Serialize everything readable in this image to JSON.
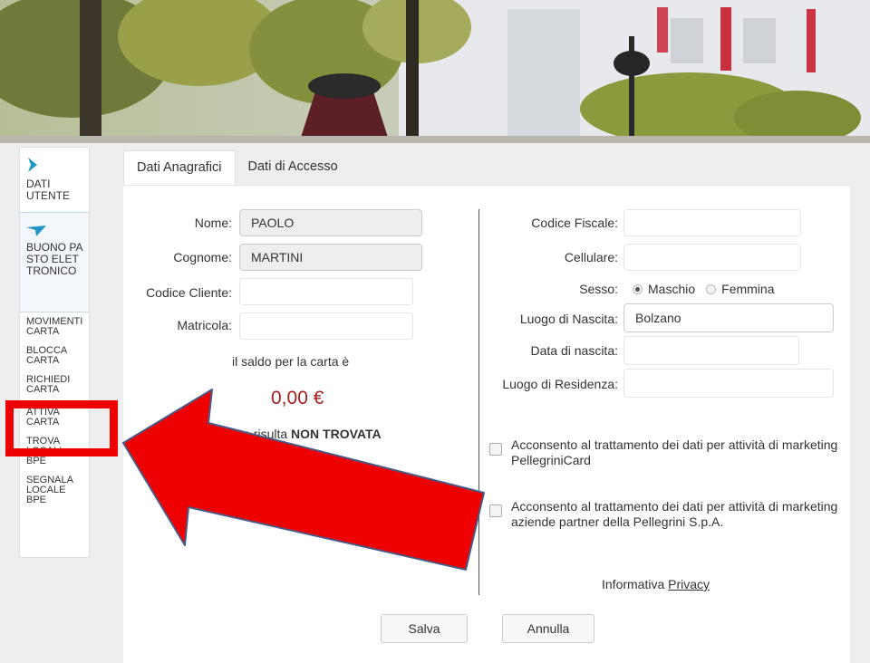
{
  "banner": {
    "icon": "street-photo-banner"
  },
  "sidebar": {
    "user_section": {
      "label": "DATI UTENTE",
      "icon": "chevron-right-icon"
    },
    "bpe_section": {
      "label": "BUONO PASTO ELETTRONICO",
      "icon": "chevron-down-icon"
    },
    "items": [
      {
        "label": "MOVIMENTI\nCARTA"
      },
      {
        "label": "BLOCCA\nCARTA"
      },
      {
        "label": "RICHIEDI\nCARTA"
      },
      {
        "label": "ATTIVA\nCARTA"
      },
      {
        "label": "TROVA\nLOCALI\nBPE"
      },
      {
        "label": "SEGNALA\nLOCALE\nBPE"
      }
    ]
  },
  "tabs": [
    {
      "label": "Dati Anagrafici",
      "active": true
    },
    {
      "label": "Dati di Accesso",
      "active": false
    }
  ],
  "form": {
    "nome": {
      "label": "Nome:",
      "value": "PAOLO"
    },
    "cognome": {
      "label": "Cognome:",
      "value": "MARTINI"
    },
    "codice_cliente": {
      "label": "Codice Cliente:",
      "value": ""
    },
    "matricola": {
      "label": "Matricola:",
      "value": ""
    },
    "codice_fiscale": {
      "label": "Codice Fiscale:",
      "value": ""
    },
    "cellulare": {
      "label": "Cellulare:",
      "value": ""
    },
    "sesso": {
      "label": "Sesso:",
      "options": [
        "Maschio",
        "Femmina"
      ],
      "selected": "Maschio"
    },
    "luogo_nascita": {
      "label": "Luogo di Nascita:",
      "value": "Bolzano"
    },
    "data_nascita": {
      "label": "Data di nascita:",
      "value": ""
    },
    "luogo_residenza": {
      "label": "Luogo di Residenza:",
      "value": ""
    }
  },
  "saldo": {
    "text": "il saldo per la carta  è",
    "value": "0,00 €",
    "status_prefix": "la carta risulta ",
    "status_bold": "NON TROVATA"
  },
  "consents": [
    {
      "text": "Acconsento al trattamento dei dati per attività di marketing PellegriniCard",
      "checked": false
    },
    {
      "text": "Acconsento al trattamento dei dati per attività di marketing aziende partner della Pellegrini S.p.A.",
      "checked": false
    }
  ],
  "privacy": {
    "prefix": "Informativa ",
    "link": "Privacy"
  },
  "buttons": {
    "save": "Salva",
    "cancel": "Annulla"
  },
  "annotation": {
    "color": "#ee0000",
    "target": "ATTIVA CARTA"
  },
  "colors": {
    "accent": "#2196c4",
    "saldo": "#a32020"
  }
}
